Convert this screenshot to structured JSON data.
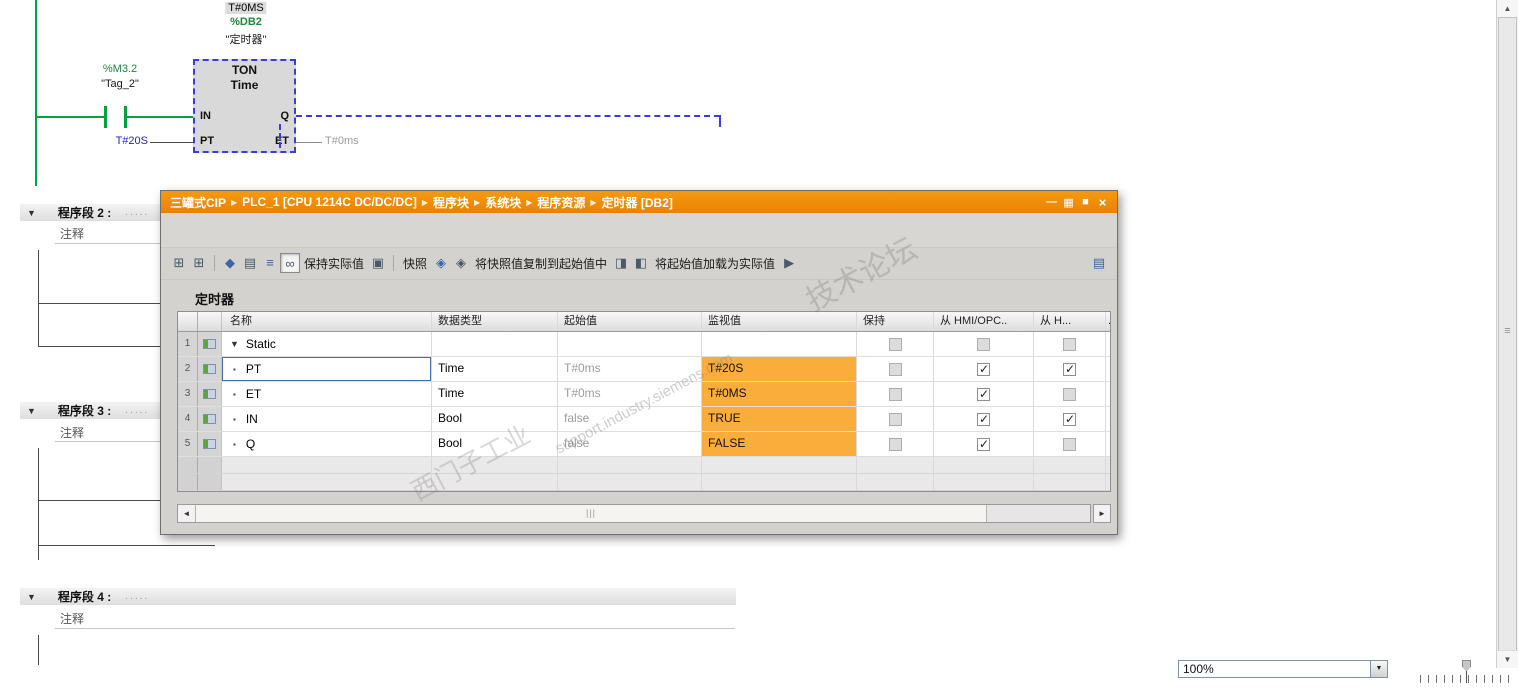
{
  "icons": {
    "expander": "▼"
  },
  "ladder": {
    "timer_monitor_value": "T#0MS",
    "db_address": "%DB2",
    "db_name": "\"定时器\"",
    "block_type": "TON",
    "block_subtype": "Time",
    "pins": {
      "in": "IN",
      "q": "Q",
      "pt": "PT",
      "et": "ET"
    },
    "contact_address": "%M3.2",
    "contact_name": "\"Tag_2\"",
    "pt_operand": "T#20S",
    "et_operand": "T#0ms"
  },
  "networks": [
    {
      "label": "程序段 2 :",
      "dots": ".....",
      "comment": "注释"
    },
    {
      "label": "程序段 3 :",
      "dots": ".....",
      "comment": "注释"
    },
    {
      "label": "程序段 4 :",
      "dots": ".....",
      "comment": "注释"
    }
  ],
  "db_window": {
    "breadcrumb": [
      "三罐式CIP",
      "PLC_1 [CPU 1214C DC/DC/DC]",
      "程序块",
      "系统块",
      "程序资源",
      "定时器 [DB2]"
    ],
    "breadcrumb_separator": "▶",
    "controls": {
      "minimize": "—",
      "float": "▦",
      "maximize": "■",
      "close": "×"
    },
    "toolbar": {
      "items": [
        {
          "kind": "icon",
          "name": "insert-row-icon",
          "glyph": "⊞"
        },
        {
          "kind": "icon",
          "name": "add-row-icon",
          "glyph": "⊞"
        },
        {
          "kind": "sep"
        },
        {
          "kind": "icon",
          "name": "download-values-icon",
          "glyph": "◆",
          "blue": true
        },
        {
          "kind": "icon",
          "name": "initialize-values-icon",
          "glyph": "▤"
        },
        {
          "kind": "icon",
          "name": "expanded-mode-icon",
          "glyph": "≡",
          "blue": true
        },
        {
          "kind": "icon",
          "name": "monitor-all-icon",
          "glyph": "∞",
          "pressed": true
        },
        {
          "kind": "text",
          "name": "keep-actual-values-button",
          "label": "保持实际值"
        },
        {
          "kind": "icon",
          "name": "keep-values-icon",
          "glyph": "▣"
        },
        {
          "kind": "sep"
        },
        {
          "kind": "text",
          "name": "snapshot-button",
          "label": "快照"
        },
        {
          "kind": "icon",
          "name": "snapshot-now-icon",
          "glyph": "◈",
          "blue": true
        },
        {
          "kind": "icon",
          "name": "load-snapshot-icon",
          "glyph": "◈"
        },
        {
          "kind": "text",
          "name": "copy-snapshot-to-start-button",
          "label": "将快照值复制到起始值中"
        },
        {
          "kind": "icon",
          "name": "copy-all-values-icon",
          "glyph": "◨"
        },
        {
          "kind": "icon",
          "name": "copy-setpoints-icon",
          "glyph": "◧"
        },
        {
          "kind": "text",
          "name": "load-start-as-actual-button",
          "label": "将起始值加载为实际值"
        },
        {
          "kind": "icon",
          "name": "more-arrow-icon",
          "glyph": "▶"
        },
        {
          "kind": "icon",
          "name": "detail-view-icon",
          "glyph": "▤",
          "blue": true,
          "right": true
        }
      ]
    },
    "table_title": "定时器",
    "columns": {
      "name": "名称",
      "datatype": "数据类型",
      "start": "起始值",
      "monitor": "监视值",
      "retain": "保持",
      "hmi_opc": "从 HMI/OPC..",
      "hmi2": "从 H...",
      "stub": "."
    },
    "rows": [
      {
        "num": "1",
        "expander": "▼",
        "name": "Static",
        "datatype": "",
        "start": "",
        "monitor": "",
        "retain": "disabled",
        "hmi_opc": "disabled",
        "hmi2": "disabled"
      },
      {
        "num": "2",
        "bullet": "▪",
        "name": "PT",
        "datatype": "Time",
        "start": "T#0ms",
        "monitor": "T#20S",
        "retain": "disabled",
        "hmi_opc": "checked",
        "hmi2": "checked",
        "selected": true
      },
      {
        "num": "3",
        "bullet": "▪",
        "name": "ET",
        "datatype": "Time",
        "start": "T#0ms",
        "monitor": "T#0MS",
        "retain": "disabled",
        "hmi_opc": "checked",
        "hmi2": "disabled"
      },
      {
        "num": "4",
        "bullet": "▪",
        "name": "IN",
        "datatype": "Bool",
        "start": "false",
        "monitor": "TRUE",
        "retain": "disabled",
        "hmi_opc": "checked",
        "hmi2": "checked"
      },
      {
        "num": "5",
        "bullet": "▪",
        "name": "Q",
        "datatype": "Bool",
        "start": "false",
        "monitor": "FALSE",
        "retain": "disabled",
        "hmi_opc": "checked",
        "hmi2": "disabled"
      }
    ],
    "hscroll_grip": "|||"
  },
  "scroll": {
    "up": "▲",
    "down": "▼",
    "left": "◄",
    "right": "►",
    "grip": "≡"
  },
  "zoom": {
    "value": "100%",
    "dropdown_arrow": "▼"
  },
  "watermark": {
    "brand": "西门子工业",
    "forum": "技术论坛",
    "site": "support.industry.siemens.com"
  }
}
